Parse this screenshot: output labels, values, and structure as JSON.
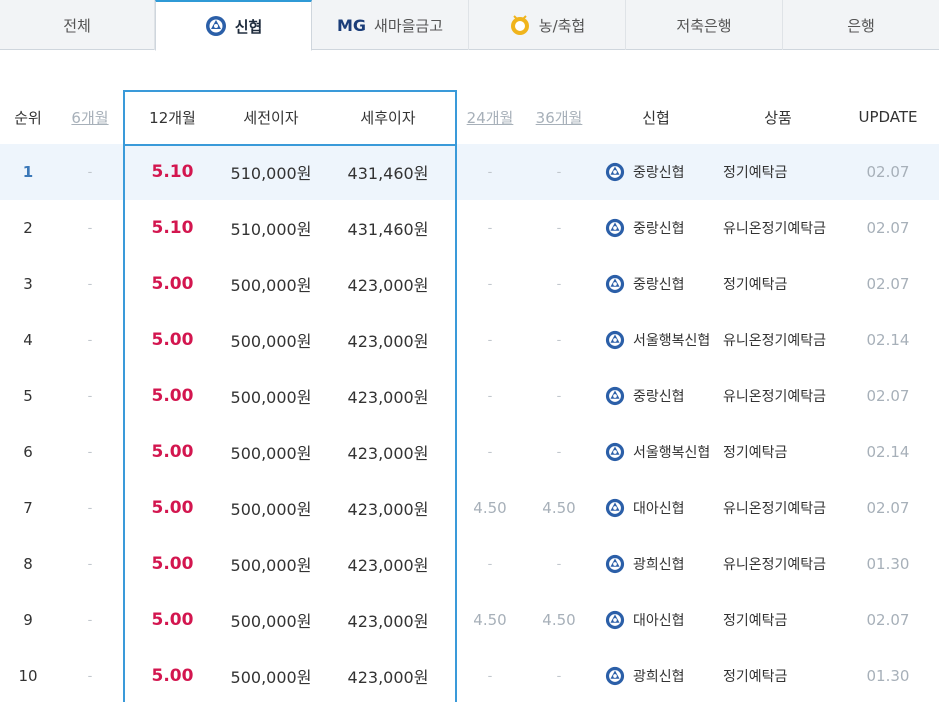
{
  "tabs": [
    {
      "label": "전체",
      "icon": "",
      "active": false
    },
    {
      "label": "신협",
      "icon": "sinhyup-logo-icon",
      "active": true
    },
    {
      "label": "새마을금고",
      "prefix": "MG",
      "icon": "mg-logo",
      "active": false
    },
    {
      "label": "농/축협",
      "icon": "nonghyup-logo-icon",
      "active": false
    },
    {
      "label": "저축은행",
      "icon": "",
      "active": false
    },
    {
      "label": "은행",
      "icon": "",
      "active": false
    }
  ],
  "table": {
    "headers": {
      "rank": "순위",
      "m6": "6개월",
      "m12": "12개월",
      "pre_tax": "세전이자",
      "post_tax": "세후이자",
      "m24": "24개월",
      "m36": "36개월",
      "bank": "신협",
      "product": "상품",
      "update": "UPDATE"
    },
    "rows": [
      {
        "rank": "1",
        "m6": "-",
        "m12": "5.10",
        "pre_tax": "510,000원",
        "post_tax": "431,460원",
        "m24": "-",
        "m36": "-",
        "bank": "중랑신협",
        "product": "정기예탁금",
        "update": "02.07"
      },
      {
        "rank": "2",
        "m6": "-",
        "m12": "5.10",
        "pre_tax": "510,000원",
        "post_tax": "431,460원",
        "m24": "-",
        "m36": "-",
        "bank": "중랑신협",
        "product": "유니온정기예탁금",
        "update": "02.07"
      },
      {
        "rank": "3",
        "m6": "-",
        "m12": "5.00",
        "pre_tax": "500,000원",
        "post_tax": "423,000원",
        "m24": "-",
        "m36": "-",
        "bank": "중랑신협",
        "product": "정기예탁금",
        "update": "02.07"
      },
      {
        "rank": "4",
        "m6": "-",
        "m12": "5.00",
        "pre_tax": "500,000원",
        "post_tax": "423,000원",
        "m24": "-",
        "m36": "-",
        "bank": "서울행복신협",
        "product": "유니온정기예탁금",
        "update": "02.14"
      },
      {
        "rank": "5",
        "m6": "-",
        "m12": "5.00",
        "pre_tax": "500,000원",
        "post_tax": "423,000원",
        "m24": "-",
        "m36": "-",
        "bank": "중랑신협",
        "product": "유니온정기예탁금",
        "update": "02.07"
      },
      {
        "rank": "6",
        "m6": "-",
        "m12": "5.00",
        "pre_tax": "500,000원",
        "post_tax": "423,000원",
        "m24": "-",
        "m36": "-",
        "bank": "서울행복신협",
        "product": "정기예탁금",
        "update": "02.14"
      },
      {
        "rank": "7",
        "m6": "-",
        "m12": "5.00",
        "pre_tax": "500,000원",
        "post_tax": "423,000원",
        "m24": "4.50",
        "m36": "4.50",
        "bank": "대아신협",
        "product": "유니온정기예탁금",
        "update": "02.07"
      },
      {
        "rank": "8",
        "m6": "-",
        "m12": "5.00",
        "pre_tax": "500,000원",
        "post_tax": "423,000원",
        "m24": "-",
        "m36": "-",
        "bank": "광희신협",
        "product": "유니온정기예탁금",
        "update": "01.30"
      },
      {
        "rank": "9",
        "m6": "-",
        "m12": "5.00",
        "pre_tax": "500,000원",
        "post_tax": "423,000원",
        "m24": "4.50",
        "m36": "4.50",
        "bank": "대아신협",
        "product": "정기예탁금",
        "update": "02.07"
      },
      {
        "rank": "10",
        "m6": "-",
        "m12": "5.00",
        "pre_tax": "500,000원",
        "post_tax": "423,000원",
        "m24": "-",
        "m36": "-",
        "bank": "광희신협",
        "product": "정기예탁금",
        "update": "01.30"
      }
    ]
  },
  "colors": {
    "accent": "#3a9ad9",
    "rate": "#d3164f",
    "highlight_row": "#eef5fc",
    "muted": "#a7b0b9"
  }
}
